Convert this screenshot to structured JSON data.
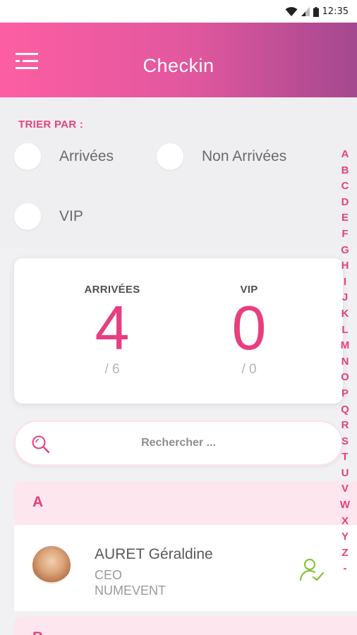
{
  "status_bar": {
    "time": "12:35",
    "icons": [
      "wifi-icon",
      "signal-icon",
      "battery-icon"
    ]
  },
  "app_bar": {
    "title": "Checkin",
    "menu_icon": "menu-icon",
    "gradient": [
      "#fd5ea3",
      "#a4488f"
    ]
  },
  "sort": {
    "title": "TRIER PAR :",
    "options": [
      {
        "label": "Arrivées",
        "selected": false
      },
      {
        "label": "Non Arrivées",
        "selected": false
      },
      {
        "label": "VIP",
        "selected": false
      }
    ]
  },
  "stats": {
    "arrived": {
      "label": "ARRIVÉES",
      "value": "4",
      "total": "/ 6"
    },
    "vip": {
      "label": "VIP",
      "value": "0",
      "total": "/ 0"
    }
  },
  "search": {
    "placeholder": "Rechercher ...",
    "icon": "search-icon"
  },
  "list": {
    "sections": [
      {
        "letter": "A",
        "contacts": [
          {
            "name": "AURET Géraldine",
            "role": "CEO",
            "company": "NUMEVENT",
            "checked_in": true
          }
        ]
      },
      {
        "letter": "B",
        "contacts": []
      }
    ]
  },
  "alphabet_index": [
    "A",
    "B",
    "C",
    "D",
    "E",
    "F",
    "G",
    "H",
    "I",
    "J",
    "K",
    "L",
    "M",
    "N",
    "O",
    "P",
    "Q",
    "R",
    "S",
    "T",
    "U",
    "V",
    "W",
    "X",
    "Y",
    "Z",
    "-"
  ],
  "colors": {
    "accent": "#e83e7f",
    "checkin_green": "#8ac23f",
    "section_bg": "#fde6ee"
  }
}
